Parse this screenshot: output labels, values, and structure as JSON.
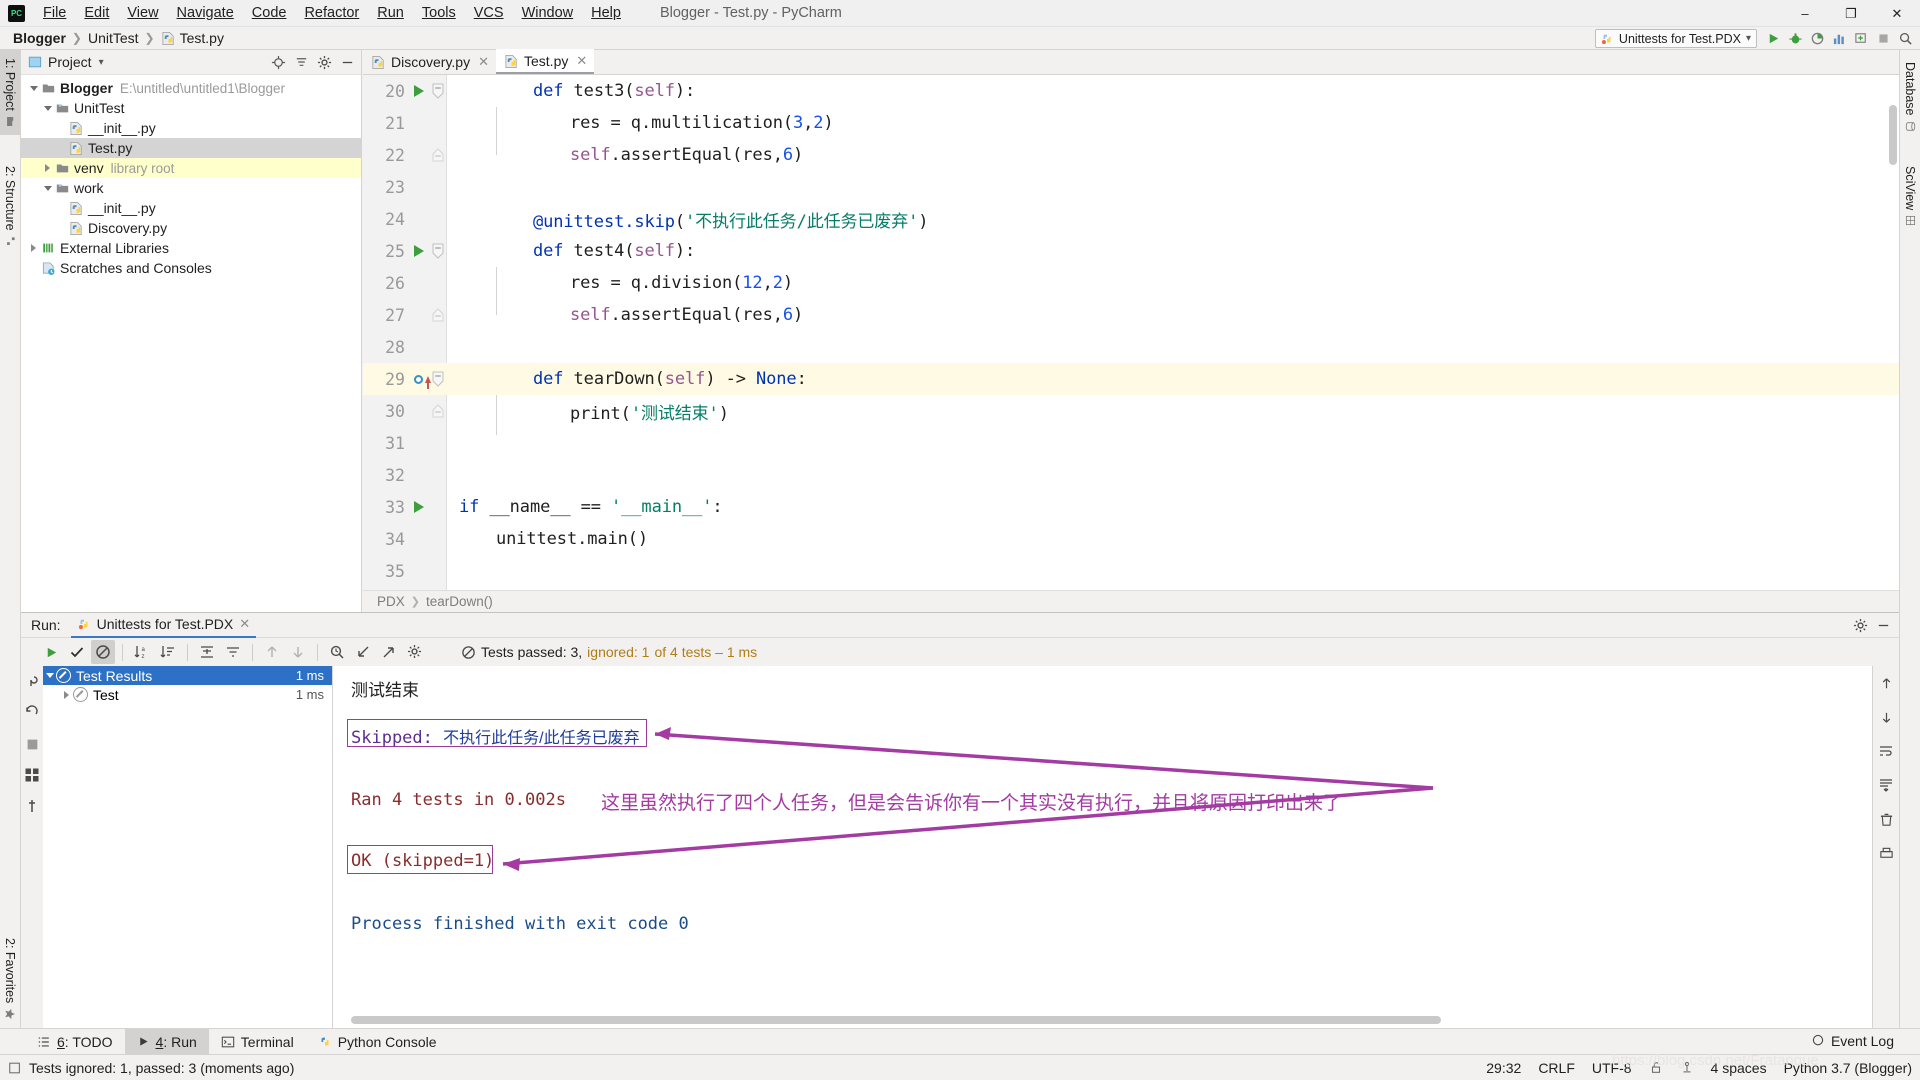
{
  "window": {
    "title": "Blogger - Test.py - PyCharm",
    "logo_text": "PC",
    "minimize": "–",
    "maximize": "❐",
    "close": "✕"
  },
  "menu": [
    {
      "label": "File"
    },
    {
      "label": "Edit"
    },
    {
      "label": "View"
    },
    {
      "label": "Navigate"
    },
    {
      "label": "Code"
    },
    {
      "label": "Refactor"
    },
    {
      "label": "Run"
    },
    {
      "label": "Tools"
    },
    {
      "label": "VCS"
    },
    {
      "label": "Window"
    },
    {
      "label": "Help"
    }
  ],
  "breadcrumbs": [
    {
      "label": "Blogger"
    },
    {
      "label": "UnitTest"
    },
    {
      "label": "Test.py"
    }
  ],
  "run_config": {
    "name": "Unittests for Test.PDX",
    "dropdown": "▾"
  },
  "left_stripe": [
    {
      "label": "1: Project",
      "active": true
    },
    {
      "label": "2: Structure",
      "active": false
    },
    {
      "label": "2: Favorites",
      "active": false
    }
  ],
  "right_stripe": [
    {
      "label": "Database",
      "active": false
    },
    {
      "label": "SciView",
      "active": false
    }
  ],
  "project_panel": {
    "title": "Project",
    "dropdown": "▾",
    "tree": [
      {
        "depth": 0,
        "twisty": "down",
        "icon": "folder-icon",
        "label": "Blogger",
        "bold": true,
        "sub": "E:\\untitled\\untitled1\\Blogger",
        "state": "none"
      },
      {
        "depth": 1,
        "twisty": "down",
        "icon": "package-folder-icon",
        "label": "UnitTest",
        "bold": false,
        "sub": "",
        "state": "none"
      },
      {
        "depth": 2,
        "twisty": "none",
        "icon": "python-file-icon",
        "label": "__init__.py",
        "bold": false,
        "sub": "",
        "state": "none"
      },
      {
        "depth": 2,
        "twisty": "none",
        "icon": "python-file-icon",
        "label": "Test.py",
        "bold": false,
        "sub": "",
        "state": "selected"
      },
      {
        "depth": 1,
        "twisty": "right",
        "icon": "folder-icon",
        "label": "venv",
        "bold": false,
        "sub": "library root",
        "state": "highlighted"
      },
      {
        "depth": 1,
        "twisty": "down",
        "icon": "package-folder-icon",
        "label": "work",
        "bold": false,
        "sub": "",
        "state": "none"
      },
      {
        "depth": 2,
        "twisty": "none",
        "icon": "python-file-icon",
        "label": "__init__.py",
        "bold": false,
        "sub": "",
        "state": "none"
      },
      {
        "depth": 2,
        "twisty": "none",
        "icon": "python-file-icon",
        "label": "Discovery.py",
        "bold": false,
        "sub": "",
        "state": "none"
      },
      {
        "depth": 0,
        "twisty": "right",
        "icon": "library-icon",
        "label": "External Libraries",
        "bold": false,
        "sub": "",
        "state": "none"
      },
      {
        "depth": 0,
        "twisty": "none",
        "icon": "scratches-icon",
        "label": "Scratches and Consoles",
        "bold": false,
        "sub": "",
        "state": "none"
      }
    ]
  },
  "editor": {
    "tabs": [
      {
        "label": "Discovery.py",
        "active": false,
        "close": "✕"
      },
      {
        "label": "Test.py",
        "active": true,
        "close": "✕"
      }
    ],
    "lines": [
      {
        "n": "20",
        "gutter_run": true,
        "fold": "minus",
        "indent": 2,
        "tokens": [
          {
            "t": "def ",
            "c": "kw"
          },
          {
            "t": "test3",
            "c": "fn"
          },
          {
            "t": "(",
            "c": "plain"
          },
          {
            "t": "self",
            "c": "selfk"
          },
          {
            "t": "):",
            "c": "plain"
          }
        ]
      },
      {
        "n": "21",
        "gutter_run": false,
        "fold": "none",
        "indent": 3,
        "tokens": [
          {
            "t": "res = q.multilication(",
            "c": "plain"
          },
          {
            "t": "3",
            "c": "num"
          },
          {
            "t": ",",
            "c": "plain"
          },
          {
            "t": "2",
            "c": "num"
          },
          {
            "t": ")",
            "c": "plain"
          }
        ]
      },
      {
        "n": "22",
        "gutter_run": false,
        "fold": "minus-end",
        "indent": 3,
        "tokens": [
          {
            "t": "self",
            "c": "selfk"
          },
          {
            "t": ".assertEqual(res,",
            "c": "plain"
          },
          {
            "t": "6",
            "c": "num"
          },
          {
            "t": ")",
            "c": "plain"
          }
        ]
      },
      {
        "n": "23",
        "gutter_run": false,
        "fold": "none",
        "indent": 0,
        "tokens": []
      },
      {
        "n": "24",
        "gutter_run": false,
        "fold": "none",
        "indent": 2,
        "tokens": [
          {
            "t": "@unittest.skip",
            "c": "dec"
          },
          {
            "t": "(",
            "c": "plain"
          },
          {
            "t": "'不执行此任务/此任务已废弃'",
            "c": "str"
          },
          {
            "t": ")",
            "c": "plain"
          }
        ]
      },
      {
        "n": "25",
        "gutter_run": true,
        "fold": "minus",
        "indent": 2,
        "tokens": [
          {
            "t": "def ",
            "c": "kw"
          },
          {
            "t": "test4",
            "c": "fn"
          },
          {
            "t": "(",
            "c": "plain"
          },
          {
            "t": "self",
            "c": "selfk"
          },
          {
            "t": "):",
            "c": "plain"
          }
        ]
      },
      {
        "n": "26",
        "gutter_run": false,
        "fold": "none",
        "indent": 3,
        "tokens": [
          {
            "t": "res = q.division(",
            "c": "plain"
          },
          {
            "t": "12",
            "c": "num"
          },
          {
            "t": ",",
            "c": "plain"
          },
          {
            "t": "2",
            "c": "num"
          },
          {
            "t": ")",
            "c": "plain"
          }
        ]
      },
      {
        "n": "27",
        "gutter_run": false,
        "fold": "minus-end",
        "indent": 3,
        "tokens": [
          {
            "t": "self",
            "c": "selfk"
          },
          {
            "t": ".assertEqual(res,",
            "c": "plain"
          },
          {
            "t": "6",
            "c": "num"
          },
          {
            "t": ")",
            "c": "plain"
          }
        ]
      },
      {
        "n": "28",
        "gutter_run": false,
        "fold": "none",
        "indent": 0,
        "tokens": []
      },
      {
        "n": "29",
        "gutter_run": false,
        "gutter_mark": true,
        "fold": "minus",
        "highlight": true,
        "indent": 2,
        "tokens": [
          {
            "t": "def ",
            "c": "kw"
          },
          {
            "t": "tearDown",
            "c": "fn"
          },
          {
            "t": "(",
            "c": "plain"
          },
          {
            "t": "self",
            "c": "selfk"
          },
          {
            "t": ") -> ",
            "c": "plain"
          },
          {
            "t": "None",
            "c": "none"
          },
          {
            "t": ":",
            "c": "plain"
          }
        ]
      },
      {
        "n": "30",
        "gutter_run": false,
        "fold": "minus-end",
        "indent": 3,
        "tokens": [
          {
            "t": "print(",
            "c": "plain"
          },
          {
            "t": "'测试结束'",
            "c": "str"
          },
          {
            "t": ")",
            "c": "plain"
          }
        ]
      },
      {
        "n": "31",
        "gutter_run": false,
        "fold": "none",
        "indent": 0,
        "tokens": []
      },
      {
        "n": "32",
        "gutter_run": false,
        "fold": "none",
        "indent": 0,
        "tokens": []
      },
      {
        "n": "33",
        "gutter_run": true,
        "fold": "none",
        "indent": 0,
        "tokens": [
          {
            "t": "if ",
            "c": "kw"
          },
          {
            "t": "__name__ == ",
            "c": "plain"
          },
          {
            "t": "'__main__'",
            "c": "str"
          },
          {
            "t": ":",
            "c": "plain"
          }
        ]
      },
      {
        "n": "34",
        "gutter_run": false,
        "fold": "none",
        "indent": 1,
        "tokens": [
          {
            "t": "unittest.main()",
            "c": "plain"
          }
        ]
      },
      {
        "n": "35",
        "gutter_run": false,
        "fold": "none",
        "indent": 0,
        "tokens": []
      }
    ],
    "breadcrumb_bottom": [
      {
        "label": "PDX"
      },
      {
        "label": "tearDown()"
      }
    ]
  },
  "run_panel": {
    "label": "Run:",
    "tab": {
      "label": "Unittests for Test.PDX",
      "close": "✕"
    },
    "status": {
      "prefix": "Tests passed: 3,",
      "ignored": "ignored: 1",
      "suffix": "of 4 tests – 1 ms"
    },
    "tests_tree": [
      {
        "label": "Test Results",
        "ms": "1 ms",
        "depth": 0,
        "twisty": "down",
        "selected": true
      },
      {
        "label": "Test",
        "ms": "1 ms",
        "depth": 1,
        "twisty": "right",
        "selected": false
      }
    ],
    "console": {
      "line_zh_out": "测试结束",
      "skipped_label": "Skipped: ",
      "skipped_reason": "不执行此任务/此任务已废弃",
      "ran": "Ran 4 tests in 0.002s",
      "ok": "OK (skipped=1)",
      "finished": "Process finished with exit code 0"
    },
    "annotation": "这里虽然执行了四个人任务，但是会告诉你有一个其实没有执行，并且将原因打印出来了",
    "annotation_color": "#a33ba3"
  },
  "bottom_tabs": [
    {
      "label": "6: TODO",
      "icon": "list-icon",
      "active": false
    },
    {
      "label": "4: Run",
      "icon": "play-icon",
      "active": true
    },
    {
      "label": "Terminal",
      "icon": "terminal-icon",
      "active": false
    },
    {
      "label": "Python Console",
      "icon": "python-icon",
      "active": false
    }
  ],
  "statusbar": {
    "message": "Tests ignored: 1, passed: 3 (moments ago)",
    "event_log": "Event Log",
    "caret": "29:32",
    "line_sep": "CRLF",
    "encoding": "UTF-8",
    "indent": "4 spaces",
    "interpreter": "Python 3.7 (Blogger)"
  },
  "watermark": "https://blog.csdn.net/Fratanque"
}
